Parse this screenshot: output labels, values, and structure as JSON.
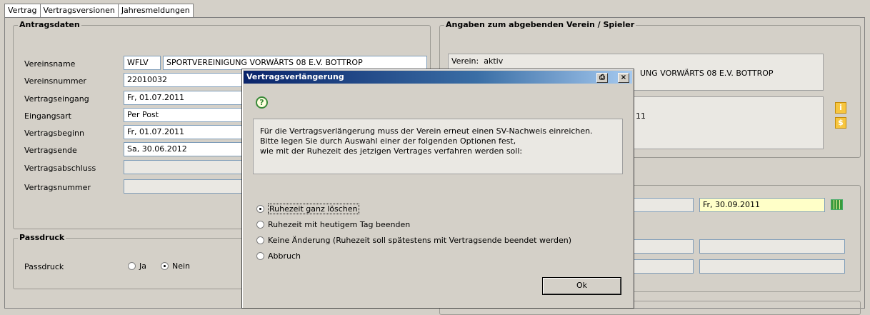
{
  "tabs": [
    "Vertrag",
    "Vertragsversionen",
    "Jahresmeldungen"
  ],
  "antragsdaten": {
    "title": "Antragsdaten",
    "rows": [
      {
        "label": "Vereinsname",
        "value": "WFLV",
        "value2": "SPORTVEREINIGUNG VORWÄRTS 08 E.V. BOTTROP"
      },
      {
        "label": "Vereinsnummer",
        "value": "22010032"
      },
      {
        "label": "Vertragseingang",
        "value": "Fr, 01.07.2011"
      },
      {
        "label": "Eingangsart",
        "value": "Per Post"
      },
      {
        "label": "Vertragsbeginn",
        "value": "Fr, 01.07.2011"
      },
      {
        "label": "Vertragsende",
        "value": "Sa, 30.06.2012"
      },
      {
        "label": "Vertragsabschluss",
        "value": ""
      },
      {
        "label": "Vertragsnummer",
        "value": ""
      }
    ]
  },
  "passdruck": {
    "title": "Passdruck",
    "label": "Passdruck",
    "options": [
      "Ja",
      "Nein"
    ],
    "selected": "Nein"
  },
  "angaben": {
    "title": "Angaben zum abgebenden Verein / Spieler",
    "verein_label": "Verein:",
    "verein_status": "aktiv",
    "verein_name_partial": "UNG VORWÄRTS 08 E.V. BOTTROP",
    "date_partial": "11",
    "ruhezeit_date": "Fr, 30.09.2011",
    "icons": [
      "info-icon",
      "dollar-icon",
      "calendar-icon"
    ]
  },
  "dialog": {
    "title": "Vertragsverlängerung",
    "message_lines": [
      "Für die Vertragsverlängerung muss der Verein erneut einen SV-Nachweis einreichen.",
      "Bitte legen Sie  durch Auswahl einer der folgenden Optionen fest,",
      "wie mit der Ruhezeit des jetzigen Vertrages verfahren werden soll:"
    ],
    "options": [
      "Ruhezeit ganz löschen",
      "Ruhezeit mit heutigem Tag beenden",
      "Keine Änderung (Ruhezeit soll spätestens mit Vertragsende beendet werden)",
      "Abbruch"
    ],
    "selected_index": 0,
    "ok_label": "Ok",
    "print_icon": "⎙",
    "close_icon": "×",
    "question_icon": "?"
  }
}
